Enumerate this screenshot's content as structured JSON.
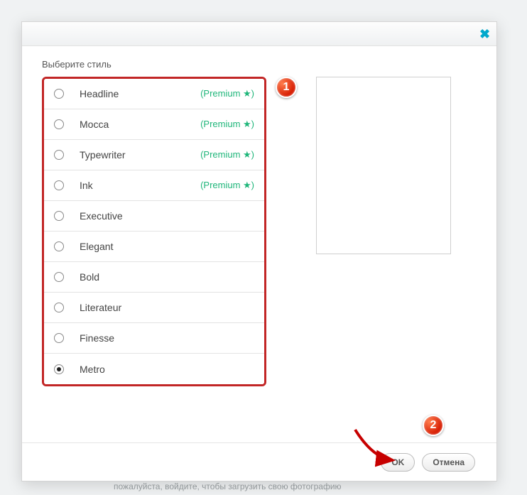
{
  "dialog": {
    "title": "Выберите стиль",
    "close_symbol": "✖",
    "styles": [
      {
        "name": "Headline",
        "premium": true,
        "selected": false
      },
      {
        "name": "Mocca",
        "premium": true,
        "selected": false
      },
      {
        "name": "Typewriter",
        "premium": true,
        "selected": false
      },
      {
        "name": "Ink",
        "premium": true,
        "selected": false
      },
      {
        "name": "Executive",
        "premium": false,
        "selected": false
      },
      {
        "name": "Elegant",
        "premium": false,
        "selected": false
      },
      {
        "name": "Bold",
        "premium": false,
        "selected": false
      },
      {
        "name": "Literateur",
        "premium": false,
        "selected": false
      },
      {
        "name": "Finesse",
        "premium": false,
        "selected": false
      },
      {
        "name": "Metro",
        "premium": false,
        "selected": true
      }
    ],
    "premium_label": "(Premium ★)",
    "ok_label": "OK",
    "cancel_label": "Отмена"
  },
  "annotations": {
    "marker1": "1",
    "marker2": "2"
  },
  "background_hint": "пожалуйста, войдите, чтобы загрузить свою фотографию"
}
